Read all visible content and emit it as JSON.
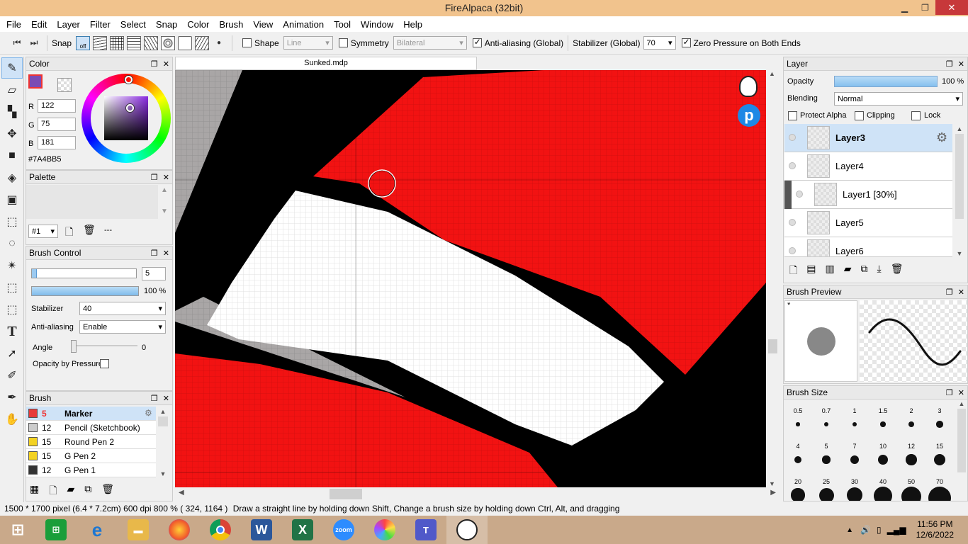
{
  "window": {
    "title": "FireAlpaca (32bit)",
    "min": "▁",
    "max": "❐",
    "close": "✕"
  },
  "menu": [
    "File",
    "Edit",
    "Layer",
    "Filter",
    "Select",
    "Snap",
    "Color",
    "Brush",
    "View",
    "Animation",
    "Tool",
    "Window",
    "Help"
  ],
  "toolbar": {
    "snap_label": "Snap",
    "snap_off": "off",
    "shape_label": "Shape",
    "shape_value": "Line",
    "symmetry_label": "Symmetry",
    "symmetry_value": "Bilateral",
    "antialias_label": "Anti-aliasing (Global)",
    "stabilizer_label": "Stabilizer (Global)",
    "stabilizer_value": "70",
    "zero_pressure_label": "Zero Pressure on Both Ends"
  },
  "color_panel": {
    "title": "Color",
    "r_label": "R",
    "r": "122",
    "g_label": "G",
    "g": "75",
    "b_label": "B",
    "b": "181",
    "hex": "#7A4BB5",
    "primary": "#7a4bb5"
  },
  "palette_panel": {
    "title": "Palette",
    "set": "#1",
    "dash": "---"
  },
  "brush_control": {
    "title": "Brush Control",
    "size": "5",
    "opacity": "100 %",
    "opacity_fraction": 1.0,
    "size_fraction": 0.05,
    "stabilizer_label": "Stabilizer",
    "stabilizer": "40",
    "antialias_label": "Anti-aliasing",
    "antialias": "Enable",
    "angle_label": "Angle",
    "angle": "0",
    "opacity_pressure_label": "Opacity by Pressure"
  },
  "brush_panel": {
    "title": "Brush",
    "items": [
      {
        "size": "5",
        "name": "Marker",
        "color": "#e83a3a"
      },
      {
        "size": "12",
        "name": "Pencil (Sketchbook)",
        "color": "#cccccc"
      },
      {
        "size": "15",
        "name": "Round Pen 2",
        "color": "#f3d222"
      },
      {
        "size": "15",
        "name": "G Pen 2",
        "color": "#f3d222"
      },
      {
        "size": "12",
        "name": "G Pen 1",
        "color": "#333333"
      }
    ]
  },
  "canvas": {
    "tab": "Sunked.mdp"
  },
  "layer_panel": {
    "title": "Layer",
    "opacity_label": "Opacity",
    "opacity": "100 %",
    "opacity_fraction": 1.0,
    "blending_label": "Blending",
    "blending": "Normal",
    "protect_alpha": "Protect Alpha",
    "clipping": "Clipping",
    "lock": "Lock",
    "layers": [
      "Layer3",
      "Layer4",
      "Layer1 [30%]",
      "Layer5",
      "Layer6"
    ]
  },
  "brush_preview": {
    "title": "Brush Preview",
    "star": "*"
  },
  "brush_size": {
    "title": "Brush Size",
    "sizes": [
      "0.5",
      "0.7",
      "1",
      "1.5",
      "2",
      "3",
      "4",
      "5",
      "7",
      "10",
      "12",
      "15",
      "20",
      "25",
      "30",
      "40",
      "50",
      "70"
    ]
  },
  "status": {
    "dims": "1500 * 1700 pixel",
    "cm": "(6.4 * 7.2cm)",
    "dpi": "600 dpi",
    "zoom": "800 %",
    "coords": "( 324, 1164 )",
    "hint": "Draw a straight line by holding down Shift, Change a brush size by holding down Ctrl, Alt, and dragging"
  },
  "taskbar": {
    "time": "11:56 PM",
    "date": "12/6/2022",
    "zoom_label": "zoom",
    "word_label": "W",
    "excel_label": "X"
  }
}
